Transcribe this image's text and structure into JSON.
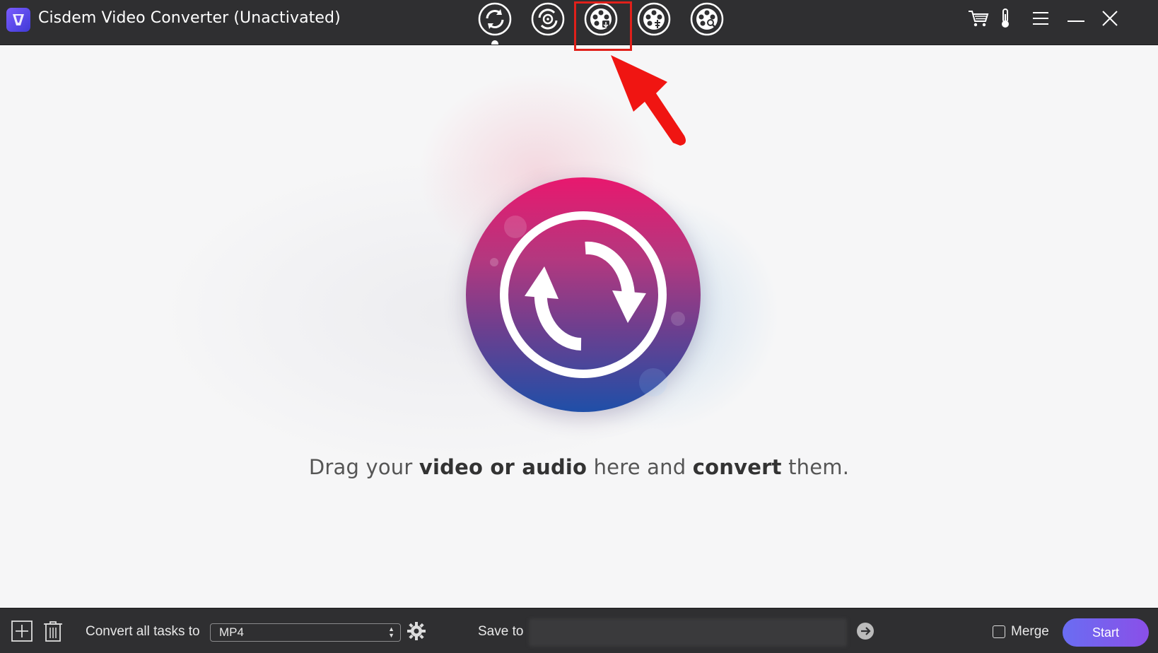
{
  "window": {
    "title": "Cisdem Video Converter (Unactivated)"
  },
  "toolbar": {
    "modes": [
      {
        "name": "convert",
        "icon": "convert-icon",
        "active": true
      },
      {
        "name": "rip",
        "icon": "rip-disc-icon",
        "active": false
      },
      {
        "name": "download",
        "icon": "download-video-icon",
        "active": false,
        "highlighted": true
      },
      {
        "name": "compress",
        "icon": "compress-video-icon",
        "active": false
      },
      {
        "name": "edit",
        "icon": "edit-video-icon",
        "active": false
      }
    ],
    "right_icons": [
      "cart-icon",
      "thermometer-icon",
      "menu-icon",
      "minimize-icon",
      "close-icon"
    ]
  },
  "main": {
    "drop_text_parts": {
      "p1": "Drag your ",
      "b1": "video or audio",
      "p2": " here and ",
      "b2": "convert",
      "p3": " them."
    }
  },
  "bottombar": {
    "convert_label": "Convert all tasks to",
    "format_value": "MP4",
    "save_label": "Save to",
    "merge_label": "Merge",
    "merge_checked": false,
    "start_label": "Start"
  },
  "colors": {
    "titlebar": "#2f2f31",
    "highlight": "#e0201a",
    "start_gradient_from": "#6a6df2",
    "start_gradient_to": "#8a4fe8"
  }
}
